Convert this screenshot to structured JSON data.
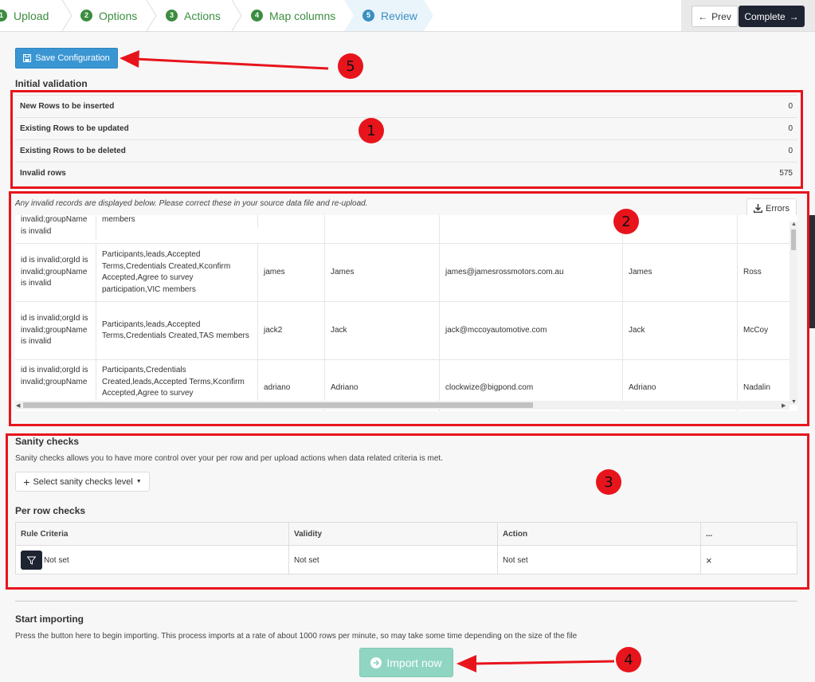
{
  "wizard": {
    "steps": [
      {
        "num": "1",
        "label": "Upload"
      },
      {
        "num": "2",
        "label": "Options"
      },
      {
        "num": "3",
        "label": "Actions"
      },
      {
        "num": "4",
        "label": "Map columns"
      },
      {
        "num": "5",
        "label": "Review"
      }
    ],
    "prev_label": "Prev",
    "complete_label": "Complete"
  },
  "save_config_label": "Save Configuration",
  "initial_validation": {
    "title": "Initial validation",
    "rows": [
      {
        "label": "New Rows to be inserted",
        "value": "0"
      },
      {
        "label": "Existing Rows to be updated",
        "value": "0"
      },
      {
        "label": "Existing Rows to be deleted",
        "value": "0"
      },
      {
        "label": "Invalid rows",
        "value": "575"
      }
    ]
  },
  "invalid_note": "Any invalid records are displayed below. Please correct these in your source data file and re-upload.",
  "errors_label": "Errors",
  "invalid_records": {
    "partial_top": {
      "error": "invalid;groupName is invalid",
      "groups": "members"
    },
    "rows": [
      {
        "error": "id is invalid;orgId is invalid;groupName is invalid",
        "groups": "Participants,leads,Accepted Terms,Credentials Created,Kconfirm Accepted,Agree to survey participation,VIC members",
        "username": "james",
        "first": "James",
        "email": "james@jamesrossmotors.com.au",
        "first2": "James",
        "last": "Ross"
      },
      {
        "error": "id is invalid;orgId is invalid;groupName is invalid",
        "groups": "Participants,leads,Accepted Terms,Credentials Created,TAS members",
        "username": "jack2",
        "first": "Jack",
        "email": "jack@mccoyautomotive.com",
        "first2": "Jack",
        "last": "McCoy"
      },
      {
        "error": "id is invalid;orgId is invalid;groupName",
        "groups": "Participants,Credentials Created,leads,Accepted Terms,Kconfirm Accepted,Agree to survey",
        "username": "adriano",
        "first": "Adriano",
        "email": "clockwize@bigpond.com",
        "first2": "Adriano",
        "last": "Nadalin"
      }
    ]
  },
  "sanity": {
    "title": "Sanity checks",
    "description": "Sanity checks allows you to have more control over your per row and per upload actions when data related criteria is met.",
    "select_label": "Select sanity checks level",
    "per_row_title": "Per row checks",
    "headers": [
      "Rule Criteria",
      "Validity",
      "Action",
      "..."
    ],
    "row": {
      "criteria": "Not set",
      "validity": "Not set",
      "action": "Not set",
      "remove": "×"
    }
  },
  "import": {
    "title": "Start importing",
    "description": "Press the button here to begin importing. This process imports at a rate of about 1000 rows per minute, so may take some time depending on the size of the file",
    "button_label": "Import now"
  },
  "annotations": [
    "1",
    "2",
    "3",
    "4",
    "5"
  ],
  "colors": {
    "annotation": "#e8141c",
    "done_step": "#3c8d40",
    "active_step": "#3a8fc1",
    "primary": "#3a96d3",
    "dark": "#1e2432",
    "import_disabled": "#8fd5c2"
  }
}
